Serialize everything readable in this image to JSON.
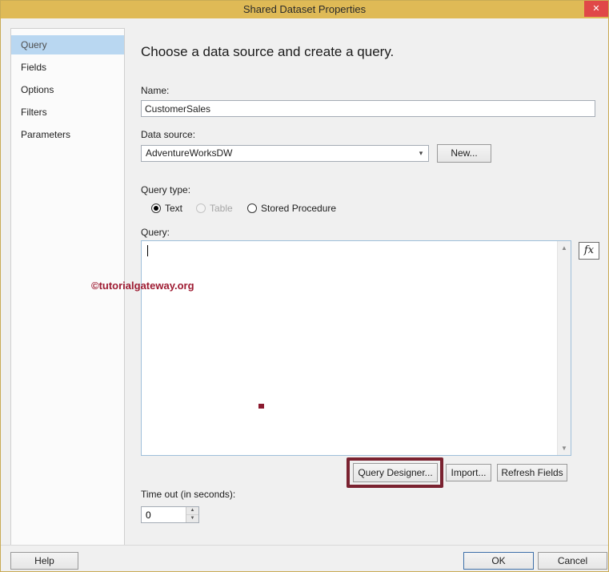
{
  "window": {
    "title": "Shared Dataset Properties"
  },
  "icons": {
    "close": "✕",
    "chevron_down": "▾",
    "arrow_up": "▲",
    "arrow_down": "▼",
    "fx": "fx"
  },
  "sidebar": {
    "items": [
      {
        "label": "Query",
        "selected": true
      },
      {
        "label": "Fields",
        "selected": false
      },
      {
        "label": "Options",
        "selected": false
      },
      {
        "label": "Filters",
        "selected": false
      },
      {
        "label": "Parameters",
        "selected": false
      }
    ]
  },
  "main": {
    "heading": "Choose a data source and create a query.",
    "name": {
      "label": "Name:",
      "value": "CustomerSales"
    },
    "data_source": {
      "label": "Data source:",
      "value": "AdventureWorksDW",
      "new_button": "New..."
    },
    "query_type": {
      "label": "Query type:",
      "options": [
        {
          "label": "Text",
          "selected": true,
          "disabled": false
        },
        {
          "label": "Table",
          "selected": false,
          "disabled": true
        },
        {
          "label": "Stored Procedure",
          "selected": false,
          "disabled": false
        }
      ]
    },
    "query": {
      "label": "Query:",
      "value": ""
    },
    "buttons": {
      "query_designer": "Query Designer...",
      "import": "Import...",
      "refresh_fields": "Refresh Fields"
    },
    "timeout": {
      "label": "Time out (in seconds):",
      "value": "0"
    }
  },
  "watermark": "©tutorialgateway.org",
  "footer": {
    "help": "Help",
    "ok": "OK",
    "cancel": "Cancel"
  },
  "colors": {
    "titlebar": "#dfba56",
    "close_button": "#e04848",
    "sidebar_selected": "#b9d7f1",
    "annotation": "#7a2230",
    "watermark": "#9e1b32",
    "ok_border": "#3d6fa8"
  }
}
